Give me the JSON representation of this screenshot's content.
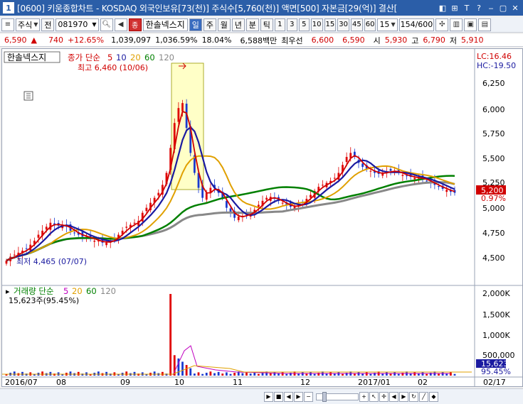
{
  "window": {
    "icon": "1",
    "title": "[0600] 키움종합차트 - KOSDAQ 외국인보유[73(천)] 주식수[5,760(천)] 액면[500] 자본금[29(억)] 결산[",
    "buttons": [
      "◧",
      "⊞",
      "T",
      "?",
      "‒",
      "▢",
      "✕"
    ]
  },
  "toolbar": {
    "market_select": "주식",
    "prev_label": "전",
    "code": "081970",
    "stock_name": "한솔넥스지",
    "day_label": "일",
    "week_label": "주",
    "month_label": "월",
    "year_label": "년",
    "minute_label": "분",
    "tick_label": "틱",
    "periods": [
      "1",
      "3",
      "5",
      "10",
      "15",
      "30",
      "45",
      "60"
    ],
    "period_select": "15",
    "count": "154",
    "count_total": "/600"
  },
  "info": {
    "price": "6,590",
    "arrow": "▲",
    "change": "740",
    "change_pct": "+12.65%",
    "volume": "1,039,097",
    "vol_ratio": "1,036.59%",
    "turnover": "18.04%",
    "amount": "6,588백만",
    "best_bid_label": "최우선",
    "best_ask": "6,600",
    "best_bid": "6,590",
    "open_label": "시",
    "open": "5,930",
    "high_label": "고",
    "high": "6,790",
    "low_label": "저",
    "low": "5,910"
  },
  "chart_data": {
    "type": "line",
    "title": "한솔넥스지",
    "price_legend": {
      "label": "종가 단순",
      "periods": [
        "5",
        "10",
        "20",
        "60",
        "120"
      ],
      "colors": [
        "#d00000",
        "#1a1aa0",
        "#e0a000",
        "#008000",
        "#888888"
      ]
    },
    "high_annotation": "최고 6,460 (10/06)",
    "low_annotation": "최저 4,465 (07/07)",
    "lc_label": "LC:16.46",
    "hc_label": "HC:-19.50",
    "price_axis": {
      "ticks": [
        "6,250",
        "6,000",
        "5,750",
        "5,500",
        "5,250",
        "5,000",
        "4,750",
        "4,500"
      ],
      "ylim": [
        4350,
        6500
      ],
      "current_price": "5,200",
      "current_pct": "0.97%"
    },
    "volume_legend": {
      "label": "거래량 단순",
      "periods": [
        "5",
        "20",
        "60",
        "120"
      ],
      "colors": [
        "#c000c0",
        "#e0a000",
        "#008000",
        "#888888"
      ]
    },
    "volume_current": "15,623주(95.45%)",
    "volume_axis": {
      "ticks": [
        "2,000K",
        "1,500K",
        "1,000K",
        "500,000"
      ],
      "current": "15,623",
      "current_pct": "95.45%"
    },
    "x_labels": [
      "2016/07",
      "08",
      "09",
      "10",
      "11",
      "12",
      "2017/01",
      "02",
      "02/17"
    ],
    "close": [
      4520,
      4560,
      4580,
      4600,
      4620,
      4640,
      4680,
      4720,
      4780,
      4820,
      4860,
      4900,
      4880,
      4870,
      4880,
      4860,
      4820,
      4800,
      4780,
      4760,
      4760,
      4740,
      4720,
      4720,
      4700,
      4700,
      4720,
      4740,
      4780,
      4820,
      4860,
      4880,
      4900,
      4920,
      5000,
      5050,
      5100,
      5150,
      5200,
      5280,
      5400,
      5650,
      5900,
      6050,
      6100,
      5850,
      5600,
      5400,
      5250,
      5150,
      5200,
      5250,
      5250,
      5200,
      5150,
      5050,
      5000,
      4950,
      4960,
      4970,
      4980,
      5000,
      5030,
      5080,
      5120,
      5150,
      5160,
      5140,
      5120,
      5100,
      5080,
      5060,
      5060,
      5080,
      5100,
      5140,
      5180,
      5220,
      5260,
      5280,
      5300,
      5320,
      5350,
      5400,
      5480,
      5560,
      5600,
      5560,
      5500,
      5460,
      5440,
      5420,
      5400,
      5390,
      5400,
      5410,
      5420,
      5420,
      5400,
      5380,
      5370,
      5360,
      5350,
      5350,
      5340,
      5320,
      5300,
      5280,
      5260,
      5240,
      5230,
      5210,
      5200
    ]
  }
}
